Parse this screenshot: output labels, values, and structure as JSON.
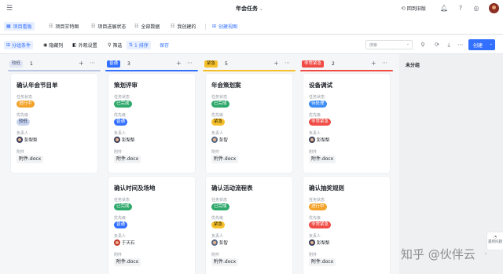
{
  "header": {
    "title": "年会任务",
    "back_label": "回到旧版"
  },
  "view_tabs": [
    {
      "label": "项目看板"
    },
    {
      "label": "项目甘特图"
    },
    {
      "label": "项目进展状态"
    },
    {
      "label": "全部数据"
    },
    {
      "label": "我创建的"
    },
    {
      "label": "创建视图"
    }
  ],
  "toolbar": {
    "group_label": "分组条件",
    "hide_label": "隐藏列",
    "appearance_label": "外观设置",
    "filter_label": "筛选",
    "sort_label": "1 排序",
    "save_label": "保存",
    "search_placeholder": "搜索",
    "create_label": "创建"
  },
  "field_labels": {
    "status": "任务状态",
    "priority": "优先级",
    "owner": "负责人",
    "attachment": "附件"
  },
  "columns": [
    {
      "tag": "较低",
      "count": "1",
      "cards": [
        {
          "title": "确认年会节目单",
          "status": "进行中",
          "priority": "较低",
          "owner": "彭梨梨",
          "file": "附件.docx"
        }
      ]
    },
    {
      "tag": "普通",
      "count": "3",
      "cards": [
        {
          "title": "策划评审",
          "status": "已完成",
          "priority": "普通",
          "owner": "彭梨梨",
          "file": "附件.docx"
        },
        {
          "title": "确认时间及场地",
          "status": "已完成",
          "priority": "普通",
          "owner": "于天石",
          "file": "附件.docx"
        }
      ]
    },
    {
      "tag": "紧急",
      "count": "5",
      "cards": [
        {
          "title": "年会策划案",
          "status": "已完成",
          "priority": "紧急",
          "owner": "彭智",
          "file": "附件.docx"
        },
        {
          "title": "确认活动流程表",
          "status": "已完成",
          "priority": "紧急",
          "owner": "彭智",
          "file": "附件.docx"
        }
      ]
    },
    {
      "tag": "非常紧急",
      "count": "2",
      "cards": [
        {
          "title": "设备调试",
          "status": "待处理",
          "priority": "非常紧急",
          "owner": "彭梨梨",
          "file": "附件.docx"
        },
        {
          "title": "确认抽奖规则",
          "status": "进行中",
          "priority": "非常紧急",
          "owner": "彭梨梨",
          "file": "附件.docx"
        }
      ]
    }
  ],
  "unassigned_label": "未分组",
  "help_label": "遇到问题",
  "watermark": "知乎 @伙伴云",
  "colors": {
    "accent": "#3370ff",
    "low": "#b9c6e4",
    "normal": "#3370ff",
    "urgent": "#f5c02b",
    "very_urgent": "#f04b45",
    "done": "#2ea86b",
    "in_progress": "#f3a32b",
    "pending": "#3c8cf5"
  }
}
